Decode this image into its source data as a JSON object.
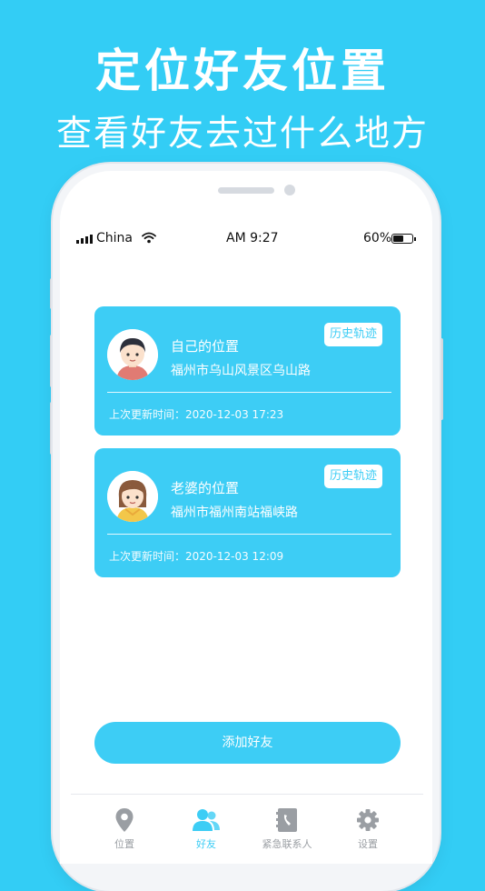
{
  "promo": {
    "title": "定位好友位置",
    "subtitle": "查看好友去过什么地方"
  },
  "status_bar": {
    "carrier": "China",
    "time": "AM 9:27",
    "battery": "60%",
    "battery_level": 0.6
  },
  "cards": [
    {
      "title": "自己的位置",
      "address": "福州市乌山风景区乌山路",
      "history_button": "历史轨迹",
      "updated": "上次更新时间：2020-12-03 17:23",
      "avatar_icon": "boy-avatar-icon"
    },
    {
      "title": "老婆的位置",
      "address": "福州市福州南站福峡路",
      "history_button": "历史轨迹",
      "updated": "上次更新时间：2020-12-03 12:09",
      "avatar_icon": "girl-avatar-icon"
    }
  ],
  "add_friend_button": "添加好友",
  "tabs": [
    {
      "label": "位置",
      "icon": "location-pin-icon",
      "active": false
    },
    {
      "label": "好友",
      "icon": "friends-icon",
      "active": true
    },
    {
      "label": "紧急联系人",
      "icon": "contacts-book-icon",
      "active": false
    },
    {
      "label": "设置",
      "icon": "gear-icon",
      "active": false
    }
  ],
  "colors": {
    "background": "#33CDF5",
    "accent": "#3DCDF5",
    "tab_inactive": "#9A9EA3"
  }
}
